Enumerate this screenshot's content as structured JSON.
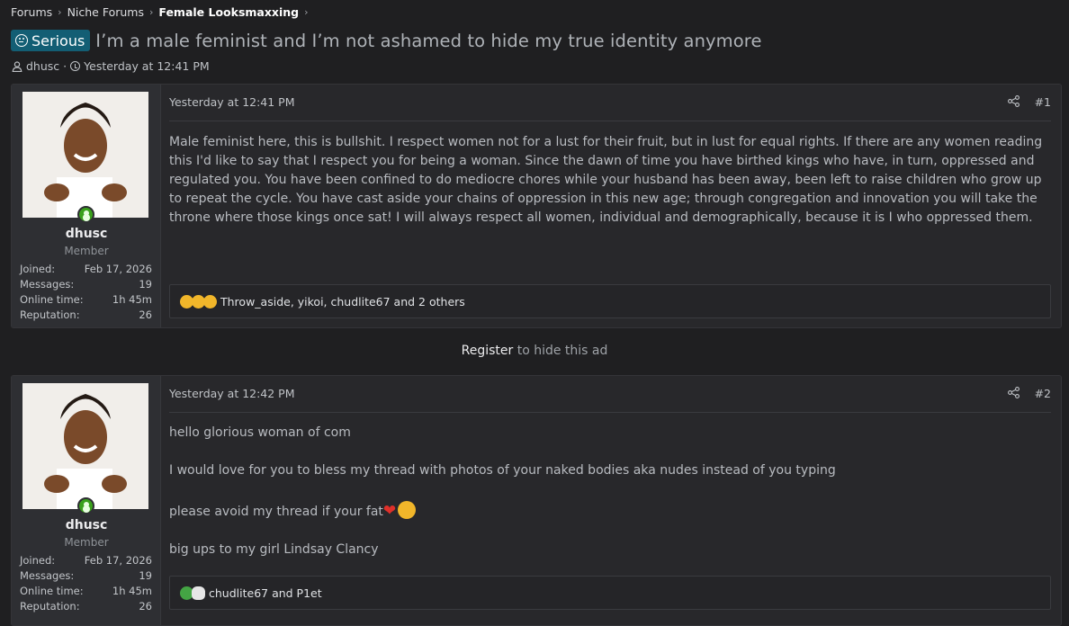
{
  "breadcrumb": {
    "items": [
      "Forums",
      "Niche Forums",
      "Female Looksmaxxing"
    ]
  },
  "thread": {
    "prefix": "Serious",
    "title": "I’m a male feminist and I’m not ashamed to hide my true identity anymore",
    "author": "dhusc",
    "separator": "·",
    "date": "Yesterday at 12:41 PM"
  },
  "ad": {
    "link_label": "Register",
    "text": " to hide this ad"
  },
  "posts": [
    {
      "user": {
        "name": "dhusc",
        "title": "Member",
        "joined_label": "Joined:",
        "joined": "Feb 17, 2026",
        "messages_label": "Messages:",
        "messages": "19",
        "online_label": "Online time:",
        "online": "1h 45m",
        "reputation_label": "Reputation:",
        "reputation": "26"
      },
      "date": "Yesterday at 12:41 PM",
      "number": "#1",
      "lines": [
        "Male feminist here, this is bullshit. I respect women not for a lust for their fruit, but in lust for equal rights. If there are any women reading this I'd like to say that I respect you for being a woman. Since the dawn of time you have birthed kings who have, in turn, oppressed and regulated you. You have been confined to do mediocre chores while your husband has been away, been left to raise children who grow up to repeat the cycle. You have cast aside your chains of oppression in this new age; through congregation and innovation you will take the throne where those kings once sat! I will always respect all women, individual and demographically, because it is I who oppressed them."
      ],
      "reactions": "Throw_aside, yikoi, chudlite67 and 2 others"
    },
    {
      "user": {
        "name": "dhusc",
        "title": "Member",
        "joined_label": "Joined:",
        "joined": "Feb 17, 2026",
        "messages_label": "Messages:",
        "messages": "19",
        "online_label": "Online time:",
        "online": "1h 45m",
        "reputation_label": "Reputation:",
        "reputation": "26"
      },
      "date": "Yesterday at 12:42 PM",
      "number": "#2",
      "lines": [
        "hello glorious woman of com",
        "I would love for you to bless my thread with photos of your naked bodies aka nudes instead of you typing",
        "please avoid my thread if your fat",
        "big ups to my girl Lindsay Clancy"
      ],
      "reactions": "chudlite67 and P1et"
    }
  ],
  "colors": {
    "prefix_bg": "#135e74",
    "online": "#3aa11c",
    "page_bg": "#1f1f21",
    "post_bg": "#28282b"
  }
}
